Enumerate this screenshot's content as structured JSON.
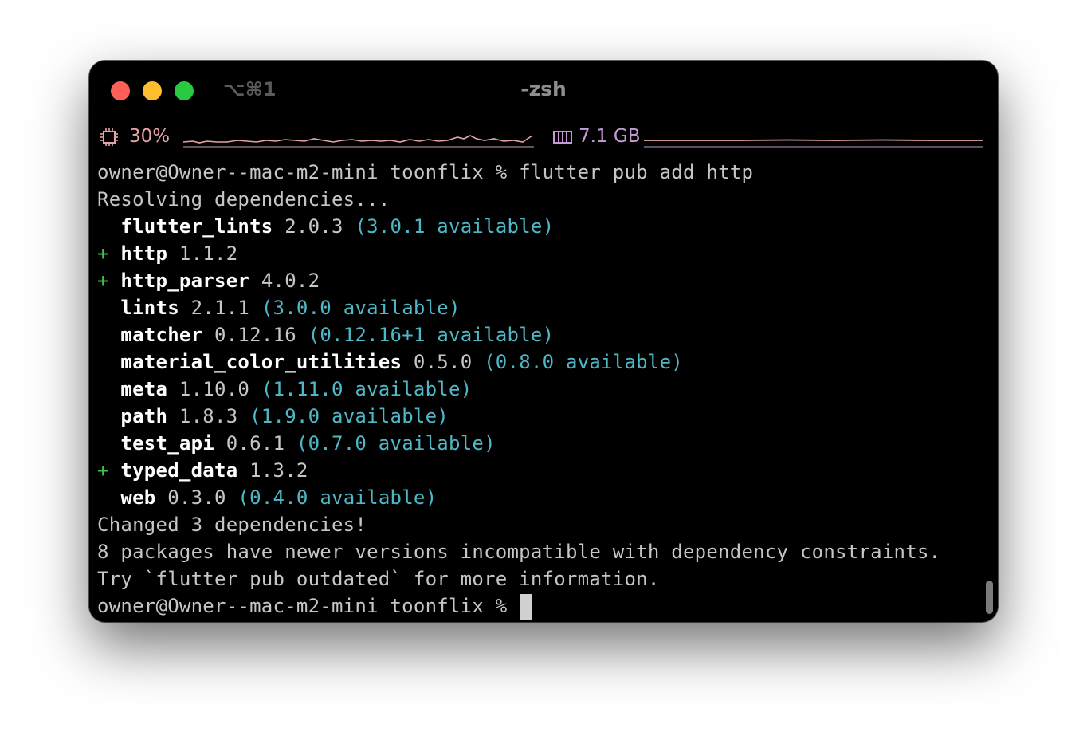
{
  "window": {
    "shortcut": "⌥⌘1",
    "title": "-zsh"
  },
  "status": {
    "cpu_icon": "cpu-chip-icon",
    "cpu_usage": "30%",
    "memory_icon": "memory-module-icon",
    "memory_usage": "7.1 GB",
    "colors": {
      "cpu": "#e8a3a8",
      "memory": "#c69ad6"
    }
  },
  "terminal": {
    "prompt": "owner@Owner--mac-m2-mini toonflix %",
    "command": "flutter pub add http",
    "resolving": "Resolving dependencies...",
    "packages": [
      {
        "marker": " ",
        "name": "flutter_lints",
        "version": "2.0.3",
        "available": "(3.0.1 available)"
      },
      {
        "marker": "+",
        "name": "http",
        "version": "1.1.2",
        "available": ""
      },
      {
        "marker": "+",
        "name": "http_parser",
        "version": "4.0.2",
        "available": ""
      },
      {
        "marker": " ",
        "name": "lints",
        "version": "2.1.1",
        "available": "(3.0.0 available)"
      },
      {
        "marker": " ",
        "name": "matcher",
        "version": "0.12.16",
        "available": "(0.12.16+1 available)"
      },
      {
        "marker": " ",
        "name": "material_color_utilities",
        "version": "0.5.0",
        "available": "(0.8.0 available)"
      },
      {
        "marker": " ",
        "name": "meta",
        "version": "1.10.0",
        "available": "(1.11.0 available)"
      },
      {
        "marker": " ",
        "name": "path",
        "version": "1.8.3",
        "available": "(1.9.0 available)"
      },
      {
        "marker": " ",
        "name": "test_api",
        "version": "0.6.1",
        "available": "(0.7.0 available)"
      },
      {
        "marker": "+",
        "name": "typed_data",
        "version": "1.3.2",
        "available": ""
      },
      {
        "marker": " ",
        "name": "web",
        "version": "0.3.0",
        "available": "(0.4.0 available)"
      }
    ],
    "changed": "Changed 3 dependencies!",
    "incompatible": "8 packages have newer versions incompatible with dependency constraints.",
    "hint": "Try `flutter pub outdated` for more information.",
    "final_prompt": "owner@Owner--mac-m2-mini toonflix %"
  }
}
